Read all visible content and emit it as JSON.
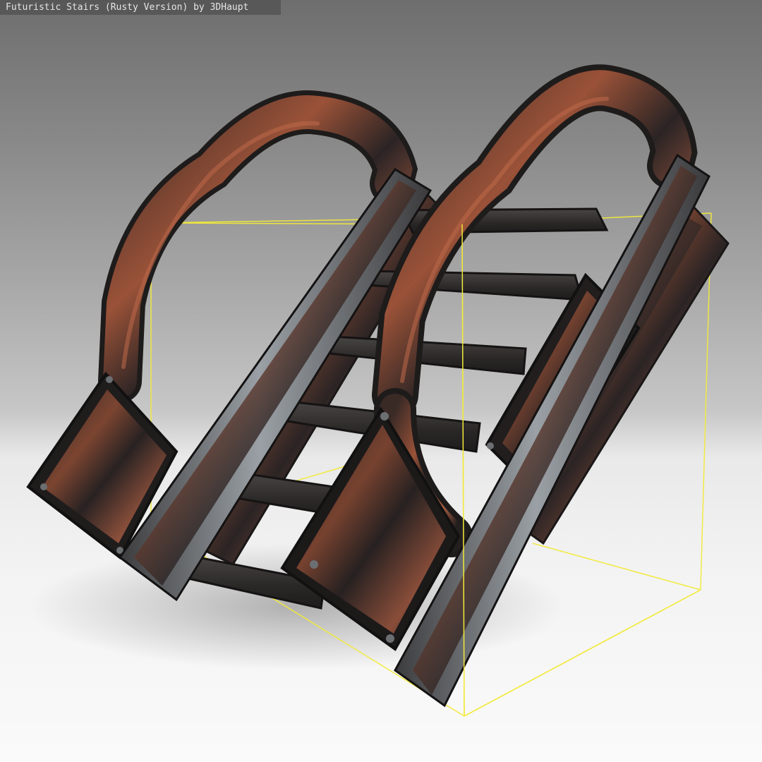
{
  "viewer": {
    "title": "Futuristic Stairs (Rusty Version) by 3DHaupt"
  },
  "model": {
    "step_count": 6
  },
  "colors": {
    "bounding_box": "#f2ea3a",
    "rust": "#a5553a",
    "dark_metal": "#2a2828",
    "steel": "#8a8e92"
  }
}
